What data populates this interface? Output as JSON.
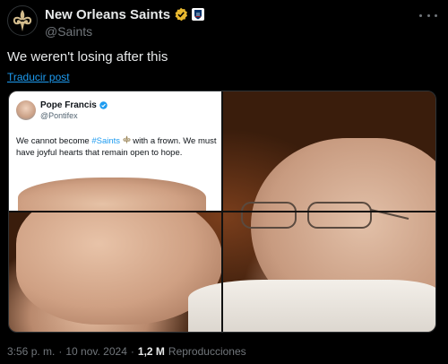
{
  "account": {
    "name": "New Orleans Saints",
    "handle": "@Saints",
    "avatar_icon": "fleur-de-lis-icon",
    "accent": "#d3bc8d"
  },
  "tweet": {
    "text": "We weren't losing after this",
    "translate_label": "Traducir post"
  },
  "embedded_post": {
    "name": "Pope Francis",
    "handle": "@Pontifex",
    "text_before": "We cannot become ",
    "hashtag": "#Saints",
    "text_after": " with a frown. We must have joyful hearts that remain open to hope.",
    "hashtag_color": "#1d9bf0"
  },
  "footer": {
    "time": "3:56 p. m.",
    "separator": "·",
    "date": "10 nov. 2024",
    "separator2": "·",
    "views_count": "1,2 M",
    "views_label": "Reproducciones"
  },
  "colors": {
    "background": "#000000",
    "text": "#e7e9ea",
    "muted": "#71767b",
    "link": "#1d9bf0",
    "verified_gold": "#e8b830"
  }
}
